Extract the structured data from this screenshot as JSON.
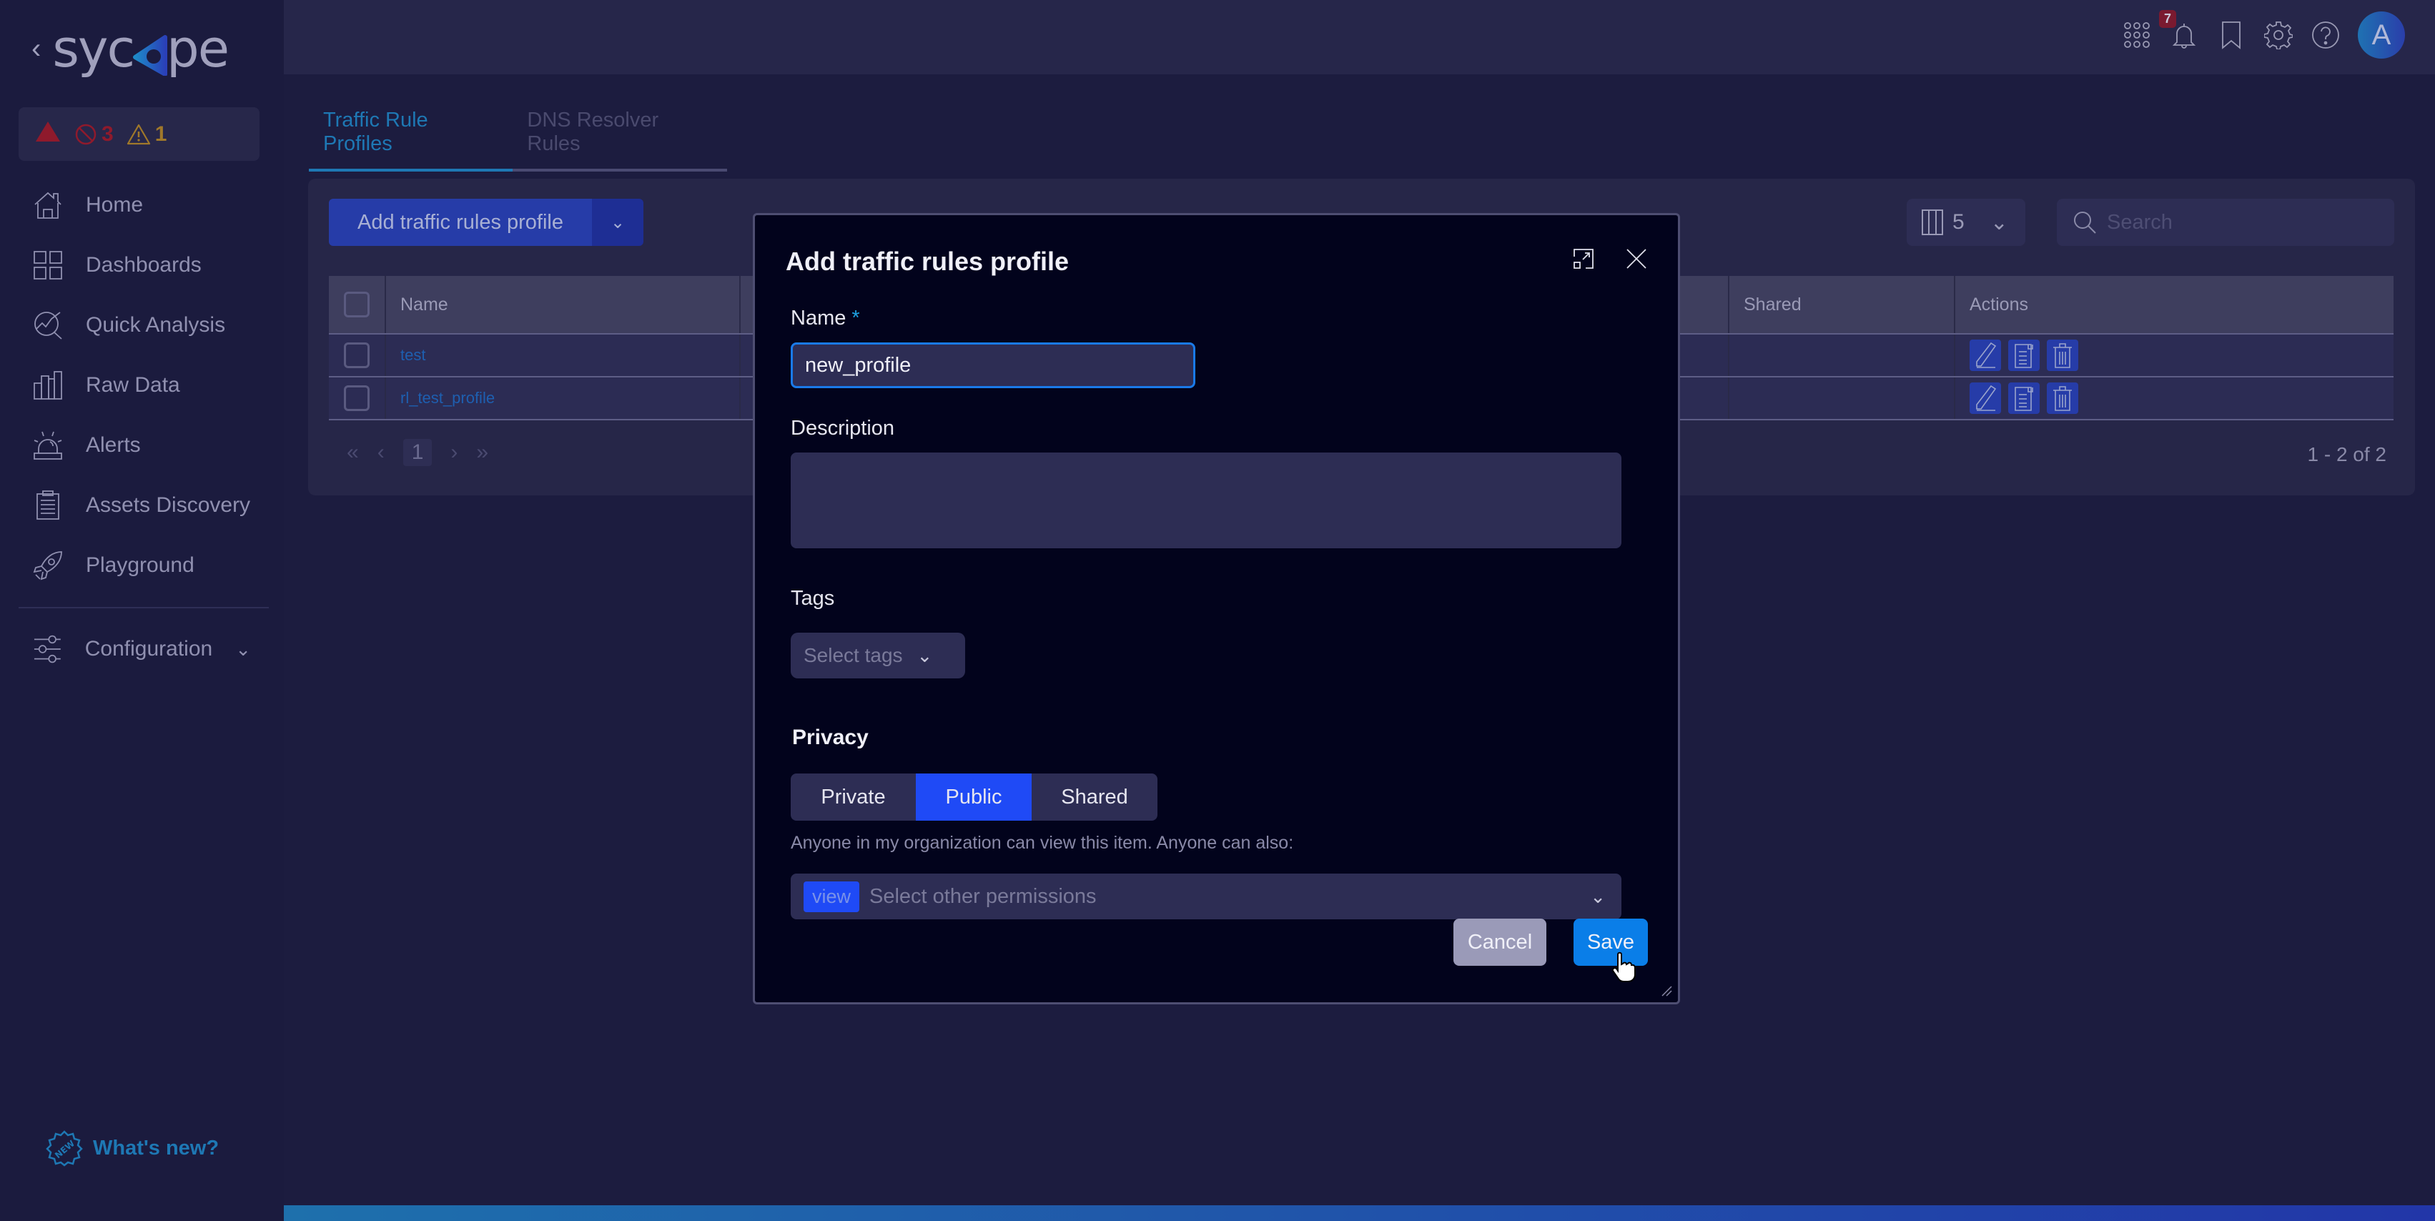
{
  "brand": {
    "name_left": "syc",
    "name_right": "pe",
    "back_icon": "chevron-left-icon"
  },
  "alerts_summary": {
    "critical_icon": "triangle-alert-icon",
    "error_count": "3",
    "warning_count": "1"
  },
  "sidebar": {
    "items": [
      {
        "label": "Home",
        "icon": "home-icon"
      },
      {
        "label": "Dashboards",
        "icon": "dashboard-grid-icon"
      },
      {
        "label": "Quick Analysis",
        "icon": "quick-analysis-icon"
      },
      {
        "label": "Raw Data",
        "icon": "bar-chart-icon"
      },
      {
        "label": "Alerts",
        "icon": "alarm-icon"
      },
      {
        "label": "Assets Discovery",
        "icon": "clipboard-icon"
      },
      {
        "label": "Playground",
        "icon": "rocket-icon"
      }
    ],
    "configuration": {
      "label": "Configuration",
      "icon": "sliders-icon"
    },
    "whats_new": "What's new?"
  },
  "topbar": {
    "notification_count": "7",
    "avatar_letter": "A"
  },
  "tabs": [
    {
      "label": "Traffic Rule Profiles",
      "active": true
    },
    {
      "label": "DNS Resolver Rules",
      "active": false
    }
  ],
  "toolbar": {
    "add_button": "Add traffic rules profile",
    "columns_count": "5",
    "search_placeholder": "Search"
  },
  "table": {
    "headers": {
      "name": "Name",
      "shared": "Shared",
      "actions": "Actions"
    },
    "rows": [
      {
        "name": "test",
        "shared": ""
      },
      {
        "name": "rl_test_profile",
        "shared": ""
      }
    ],
    "pagination": {
      "current_page": "1",
      "range": "1 - 2 of 2"
    }
  },
  "modal": {
    "title": "Add traffic rules profile",
    "name_label": "Name",
    "name_required": "*",
    "name_value": "new_profile",
    "description_label": "Description",
    "description_value": "",
    "tags_label": "Tags",
    "tags_placeholder": "Select tags",
    "privacy_label": "Privacy",
    "privacy_options": [
      {
        "label": "Private",
        "active": false
      },
      {
        "label": "Public",
        "active": true
      },
      {
        "label": "Shared",
        "active": false
      }
    ],
    "privacy_hint": "Anyone in my organization can view this item. Anyone can also:",
    "permission_chip": "view",
    "permission_placeholder": "Select other permissions",
    "cancel_label": "Cancel",
    "save_label": "Save"
  },
  "colors": {
    "accent": "#1e78b4",
    "primary_button": "#263ca8",
    "active_segment": "#1f4af6",
    "save_button": "#0a7ee8",
    "error": "#8f1a2c",
    "warning": "#a0782a"
  }
}
